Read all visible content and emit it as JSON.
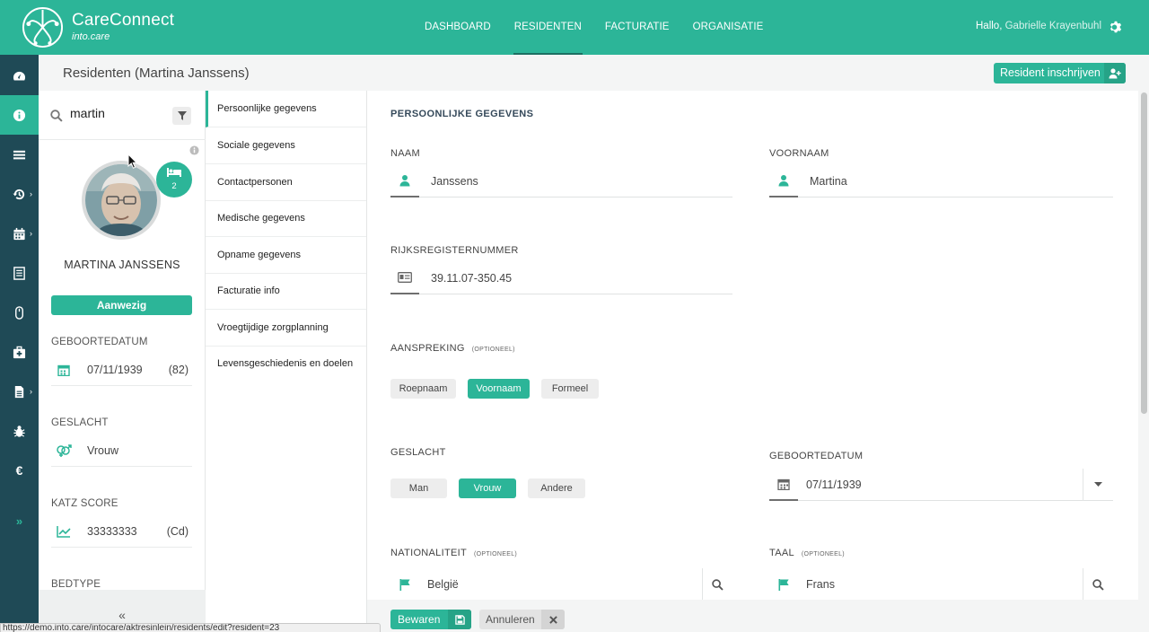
{
  "app": {
    "name": "CareConnect",
    "subtitle": "into.care"
  },
  "nav": {
    "items": [
      {
        "label": "DASHBOARD"
      },
      {
        "label": "RESIDENTEN"
      },
      {
        "label": "FACTURATIE"
      },
      {
        "label": "ORGANISATIE"
      }
    ],
    "active": "RESIDENTEN"
  },
  "user": {
    "greeting": "Hallo,",
    "name": "Gabrielle Krayenbuhl"
  },
  "rail": {
    "icons": [
      "dashboard-icon",
      "info-icon",
      "list-icon",
      "history-icon",
      "calendar-icon",
      "report-icon",
      "mouse-icon",
      "medkit-icon",
      "document-icon",
      "bug-icon",
      "euro-icon",
      "expand-icon"
    ],
    "euro_glyph": "€",
    "expand_glyph": "»",
    "chevron_glyph": "›"
  },
  "header": {
    "title": "Residenten (Martina Janssens)",
    "register_button": "Resident inschrijven"
  },
  "profile": {
    "search_value": "martin",
    "bed_count": "2",
    "name": "MARTINA JANSSENS",
    "status": "Aanwezig",
    "birthdate_label": "GEBOORTEDATUM",
    "birthdate": "07/11/1939",
    "age": "(82)",
    "gender_label": "GESLACHT",
    "gender": "Vrouw",
    "katz_label": "KATZ SCORE",
    "katz": "33333333",
    "katz_code": "(Cd)",
    "bedtype_label": "BEDTYPE",
    "collapse_glyph": "«"
  },
  "submenu": [
    {
      "label": "Persoonlijke gegevens"
    },
    {
      "label": "Sociale gegevens"
    },
    {
      "label": "Contactpersonen"
    },
    {
      "label": "Medische gegevens"
    },
    {
      "label": "Opname gegevens"
    },
    {
      "label": "Facturatie info"
    },
    {
      "label": "Vroegtijdige zorgplanning"
    },
    {
      "label": "Levensgeschiedenis en doelen"
    }
  ],
  "form": {
    "section_title": "PERSOONLIJKE GEGEVENS",
    "naam_label": "NAAM",
    "naam": "Janssens",
    "voornaam_label": "VOORNAAM",
    "voornaam": "Martina",
    "rr_label": "RIJKSREGISTERNUMMER",
    "rr": "39.11.07-350.45",
    "aanspreking_label": "AANSPREKING",
    "optional": "(OPTIONEEL)",
    "aanspreking_options": [
      "Roepnaam",
      "Voornaam",
      "Formeel"
    ],
    "aanspreking_selected": "Voornaam",
    "geslacht_label": "GESLACHT",
    "geslacht_options": [
      "Man",
      "Vrouw",
      "Andere"
    ],
    "geslacht_selected": "Vrouw",
    "geboortedatum_label": "GEBOORTEDATUM",
    "geboortedatum": "07/11/1939",
    "nationaliteit_label": "NATIONALITEIT",
    "nationaliteit": "België",
    "taal_label": "TAAL",
    "taal": "Frans"
  },
  "actions": {
    "save": "Bewaren",
    "cancel": "Annuleren"
  },
  "status_url": "https://demo.into.care/intocare/aktresinlein/residents/edit?resident=23",
  "colors": {
    "brand": "#2cb598",
    "rail": "#1f4a56"
  }
}
